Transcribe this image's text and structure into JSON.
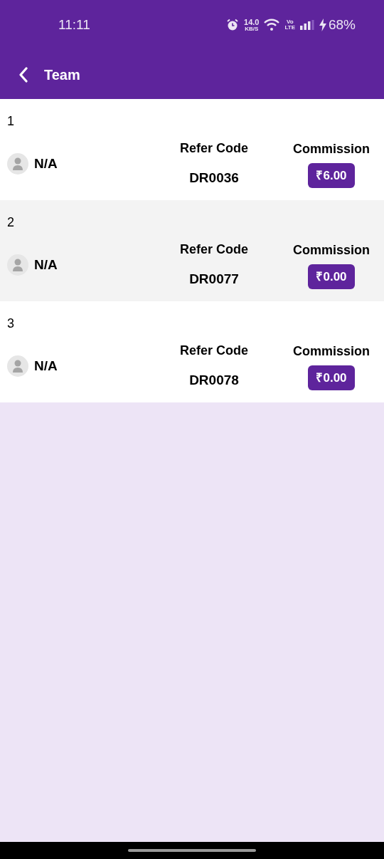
{
  "status_bar": {
    "time": "11:11",
    "speed_value": "14.0",
    "speed_unit": "KB/S",
    "volte_top": "Vo",
    "volte_bottom": "LTE",
    "battery": "68%"
  },
  "app_bar": {
    "title": "Team"
  },
  "members": [
    {
      "index": "1",
      "name": "N/A",
      "code_label": "Refer Code",
      "code": "DR0036",
      "commission_label": "Commission",
      "commission": "₹6.00"
    },
    {
      "index": "2",
      "name": "N/A",
      "code_label": "Refer Code",
      "code": "DR0077",
      "commission_label": "Commission",
      "commission": "₹0.00"
    },
    {
      "index": "3",
      "name": "N/A",
      "code_label": "Refer Code",
      "code": "DR0078",
      "commission_label": "Commission",
      "commission": "₹0.00"
    }
  ]
}
